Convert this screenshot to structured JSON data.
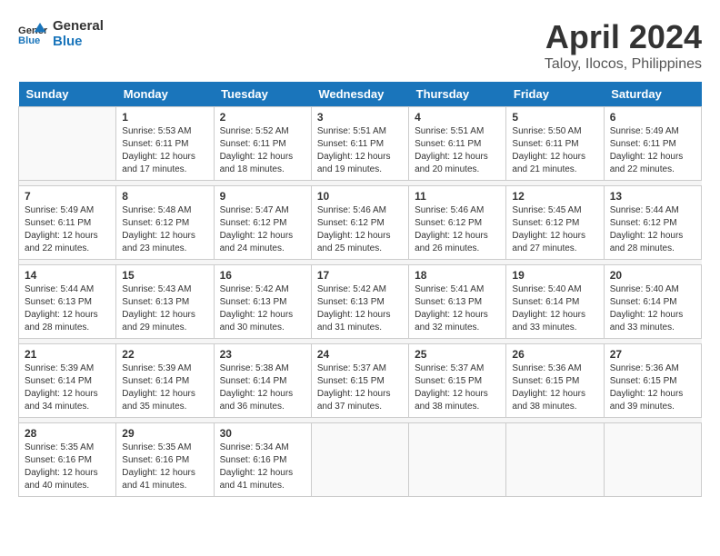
{
  "logo": {
    "text_general": "General",
    "text_blue": "Blue"
  },
  "title": "April 2024",
  "subtitle": "Taloy, Ilocos, Philippines",
  "days_header": [
    "Sunday",
    "Monday",
    "Tuesday",
    "Wednesday",
    "Thursday",
    "Friday",
    "Saturday"
  ],
  "weeks": [
    {
      "days": [
        {
          "num": "",
          "info": ""
        },
        {
          "num": "1",
          "info": "Sunrise: 5:53 AM\nSunset: 6:11 PM\nDaylight: 12 hours\nand 17 minutes."
        },
        {
          "num": "2",
          "info": "Sunrise: 5:52 AM\nSunset: 6:11 PM\nDaylight: 12 hours\nand 18 minutes."
        },
        {
          "num": "3",
          "info": "Sunrise: 5:51 AM\nSunset: 6:11 PM\nDaylight: 12 hours\nand 19 minutes."
        },
        {
          "num": "4",
          "info": "Sunrise: 5:51 AM\nSunset: 6:11 PM\nDaylight: 12 hours\nand 20 minutes."
        },
        {
          "num": "5",
          "info": "Sunrise: 5:50 AM\nSunset: 6:11 PM\nDaylight: 12 hours\nand 21 minutes."
        },
        {
          "num": "6",
          "info": "Sunrise: 5:49 AM\nSunset: 6:11 PM\nDaylight: 12 hours\nand 22 minutes."
        }
      ]
    },
    {
      "days": [
        {
          "num": "7",
          "info": "Sunrise: 5:49 AM\nSunset: 6:11 PM\nDaylight: 12 hours\nand 22 minutes."
        },
        {
          "num": "8",
          "info": "Sunrise: 5:48 AM\nSunset: 6:12 PM\nDaylight: 12 hours\nand 23 minutes."
        },
        {
          "num": "9",
          "info": "Sunrise: 5:47 AM\nSunset: 6:12 PM\nDaylight: 12 hours\nand 24 minutes."
        },
        {
          "num": "10",
          "info": "Sunrise: 5:46 AM\nSunset: 6:12 PM\nDaylight: 12 hours\nand 25 minutes."
        },
        {
          "num": "11",
          "info": "Sunrise: 5:46 AM\nSunset: 6:12 PM\nDaylight: 12 hours\nand 26 minutes."
        },
        {
          "num": "12",
          "info": "Sunrise: 5:45 AM\nSunset: 6:12 PM\nDaylight: 12 hours\nand 27 minutes."
        },
        {
          "num": "13",
          "info": "Sunrise: 5:44 AM\nSunset: 6:12 PM\nDaylight: 12 hours\nand 28 minutes."
        }
      ]
    },
    {
      "days": [
        {
          "num": "14",
          "info": "Sunrise: 5:44 AM\nSunset: 6:13 PM\nDaylight: 12 hours\nand 28 minutes."
        },
        {
          "num": "15",
          "info": "Sunrise: 5:43 AM\nSunset: 6:13 PM\nDaylight: 12 hours\nand 29 minutes."
        },
        {
          "num": "16",
          "info": "Sunrise: 5:42 AM\nSunset: 6:13 PM\nDaylight: 12 hours\nand 30 minutes."
        },
        {
          "num": "17",
          "info": "Sunrise: 5:42 AM\nSunset: 6:13 PM\nDaylight: 12 hours\nand 31 minutes."
        },
        {
          "num": "18",
          "info": "Sunrise: 5:41 AM\nSunset: 6:13 PM\nDaylight: 12 hours\nand 32 minutes."
        },
        {
          "num": "19",
          "info": "Sunrise: 5:40 AM\nSunset: 6:14 PM\nDaylight: 12 hours\nand 33 minutes."
        },
        {
          "num": "20",
          "info": "Sunrise: 5:40 AM\nSunset: 6:14 PM\nDaylight: 12 hours\nand 33 minutes."
        }
      ]
    },
    {
      "days": [
        {
          "num": "21",
          "info": "Sunrise: 5:39 AM\nSunset: 6:14 PM\nDaylight: 12 hours\nand 34 minutes."
        },
        {
          "num": "22",
          "info": "Sunrise: 5:39 AM\nSunset: 6:14 PM\nDaylight: 12 hours\nand 35 minutes."
        },
        {
          "num": "23",
          "info": "Sunrise: 5:38 AM\nSunset: 6:14 PM\nDaylight: 12 hours\nand 36 minutes."
        },
        {
          "num": "24",
          "info": "Sunrise: 5:37 AM\nSunset: 6:15 PM\nDaylight: 12 hours\nand 37 minutes."
        },
        {
          "num": "25",
          "info": "Sunrise: 5:37 AM\nSunset: 6:15 PM\nDaylight: 12 hours\nand 38 minutes."
        },
        {
          "num": "26",
          "info": "Sunrise: 5:36 AM\nSunset: 6:15 PM\nDaylight: 12 hours\nand 38 minutes."
        },
        {
          "num": "27",
          "info": "Sunrise: 5:36 AM\nSunset: 6:15 PM\nDaylight: 12 hours\nand 39 minutes."
        }
      ]
    },
    {
      "days": [
        {
          "num": "28",
          "info": "Sunrise: 5:35 AM\nSunset: 6:16 PM\nDaylight: 12 hours\nand 40 minutes."
        },
        {
          "num": "29",
          "info": "Sunrise: 5:35 AM\nSunset: 6:16 PM\nDaylight: 12 hours\nand 41 minutes."
        },
        {
          "num": "30",
          "info": "Sunrise: 5:34 AM\nSunset: 6:16 PM\nDaylight: 12 hours\nand 41 minutes."
        },
        {
          "num": "",
          "info": ""
        },
        {
          "num": "",
          "info": ""
        },
        {
          "num": "",
          "info": ""
        },
        {
          "num": "",
          "info": ""
        }
      ]
    }
  ]
}
